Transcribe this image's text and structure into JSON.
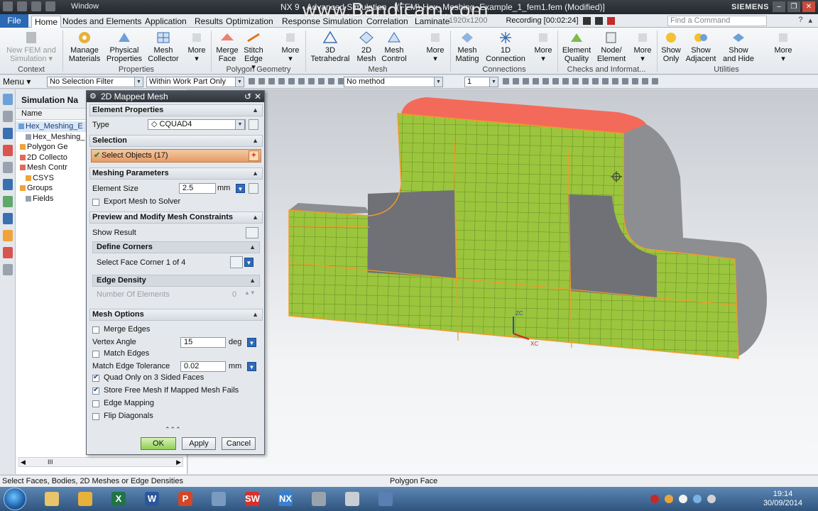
{
  "window": {
    "title": "NX 9 - Advanced Simulation - [(FEM) Hex_Meshing_Example_1_fem1.fem (Modified)]",
    "menu_label": "Window",
    "brand": "SIEMENS",
    "controls": [
      "–",
      "❐",
      "✕"
    ]
  },
  "overlay": {
    "watermark": "www.Bandicam.com",
    "resolution": "1920x1200",
    "recording": "Recording [00:02:24]"
  },
  "tabs": [
    "File",
    "Home",
    "Nodes and Elements",
    "Application",
    "Results",
    "Optimization",
    "Response Simulation",
    "Correlation",
    "Laminate"
  ],
  "active_tab": "Home",
  "command_finder_placeholder": "Find a Command",
  "ribbon": {
    "buttons": [
      {
        "label": "New FEM and Simulation",
        "line1": "New FEM and",
        "line2": "Simulation ▾",
        "enabled": false
      },
      {
        "line1": "Manage",
        "line2": "Materials"
      },
      {
        "line1": "Physical",
        "line2": "Properties"
      },
      {
        "line1": "Mesh",
        "line2": "Collector"
      },
      {
        "line1": "More",
        "line2": "▾"
      },
      {
        "line1": "Merge",
        "line2": "Face"
      },
      {
        "line1": "Stitch",
        "line2": "Edge ▾"
      },
      {
        "line1": "More",
        "line2": "▾"
      },
      {
        "line1": "3D",
        "line2": "Tetrahedral"
      },
      {
        "line1": "2D",
        "line2": "Mesh"
      },
      {
        "line1": "Mesh",
        "line2": "Control"
      },
      {
        "line1": "More",
        "line2": "▾"
      },
      {
        "line1": "Mesh",
        "line2": "Mating"
      },
      {
        "line1": "1D",
        "line2": "Connection"
      },
      {
        "line1": "More",
        "line2": "▾"
      },
      {
        "line1": "Element",
        "line2": "Quality"
      },
      {
        "line1": "Node/",
        "line2": "Element"
      },
      {
        "line1": "More",
        "line2": "▾"
      },
      {
        "line1": "Show",
        "line2": "Only"
      },
      {
        "line1": "Show",
        "line2": "Adjacent"
      },
      {
        "line1": "Show",
        "line2": "and Hide"
      },
      {
        "line1": "More",
        "line2": "▾"
      }
    ],
    "groups": [
      "Context",
      "Properties",
      "Polygon Geometry",
      "Mesh",
      "Connections",
      "Checks and Informat...",
      "Utilities"
    ]
  },
  "toolbar": {
    "menu_label": "Menu ▾",
    "selection_filter": "No Selection Filter",
    "scope": "Within Work Part Only",
    "snap_method": "No method",
    "level": "1"
  },
  "navigator": {
    "title": "Simulation Na",
    "column": "Name",
    "items": [
      {
        "label": "Hex_Meshing_E",
        "selected": true
      },
      {
        "label": "Hex_Meshing_"
      },
      {
        "label": "Polygon Ge"
      },
      {
        "label": "2D Collecto"
      },
      {
        "label": "Mesh Contr"
      },
      {
        "label": "CSYS"
      },
      {
        "label": "Groups"
      },
      {
        "label": "Fields"
      }
    ],
    "scroll_glyph": "III"
  },
  "dialog": {
    "title": "2D Mapped Mesh",
    "sections": {
      "element_properties": "Element Properties",
      "selection": "Selection",
      "meshing_parameters": "Meshing Parameters",
      "preview": "Preview and Modify Mesh Constraints",
      "mesh_options": "Mesh Options"
    },
    "type_label": "Type",
    "type_value": "◇ CQUAD4",
    "select_objects": "Select Objects (17)",
    "element_size_label": "Element Size",
    "element_size_value": "2.5",
    "element_size_unit": "mm",
    "export_label": "Export Mesh to Solver",
    "show_result": "Show Result",
    "define_corners": "Define Corners",
    "select_corner": "Select Face Corner 1 of 4",
    "edge_density": "Edge Density",
    "num_elements_label": "Number Of Elements",
    "num_elements_value": "0",
    "merge_edges": "Merge Edges",
    "vertex_angle_label": "Vertex Angle",
    "vertex_angle_value": "15",
    "vertex_angle_unit": "deg",
    "match_edges": "Match Edges",
    "match_tol_label": "Match Edge Tolerance",
    "match_tol_value": "0.02",
    "match_tol_unit": "mm",
    "quad_only": "Quad Only on 3 Sided Faces",
    "store_free": "Store Free Mesh If Mapped Mesh Fails",
    "edge_mapping": "Edge Mapping",
    "flip_diagonals": "Flip Diagonals",
    "checks": {
      "export": false,
      "merge": false,
      "match": false,
      "quad": true,
      "store": true,
      "edge_map": false,
      "flip": false
    },
    "ok": "OK",
    "apply": "Apply",
    "cancel": "Cancel"
  },
  "viewport": {
    "triad_x": "XC",
    "triad_z": "ZC",
    "colors": {
      "mesh_face": "#9bc53d",
      "mesh_line": "#5a7a1f",
      "top_face": "#f36a5a",
      "body_gray": "#8c8e92",
      "edge_orange": "#f39a2a"
    }
  },
  "status": {
    "prompt": "Select Faces, Bodies, 2D Meshes or Edge Densities",
    "filter": "Polygon Face"
  },
  "taskbar": {
    "time": "19:14",
    "date": "30/09/2014",
    "apps": [
      "explorer",
      "chrome",
      "excel",
      "word",
      "powerpoint",
      "tools",
      "solidworks",
      "nx",
      "paint",
      "calculator",
      "network"
    ],
    "app_glyphs": [
      "",
      "",
      "X",
      "W",
      "P",
      "",
      "SW",
      "NX",
      "",
      "",
      ""
    ]
  }
}
